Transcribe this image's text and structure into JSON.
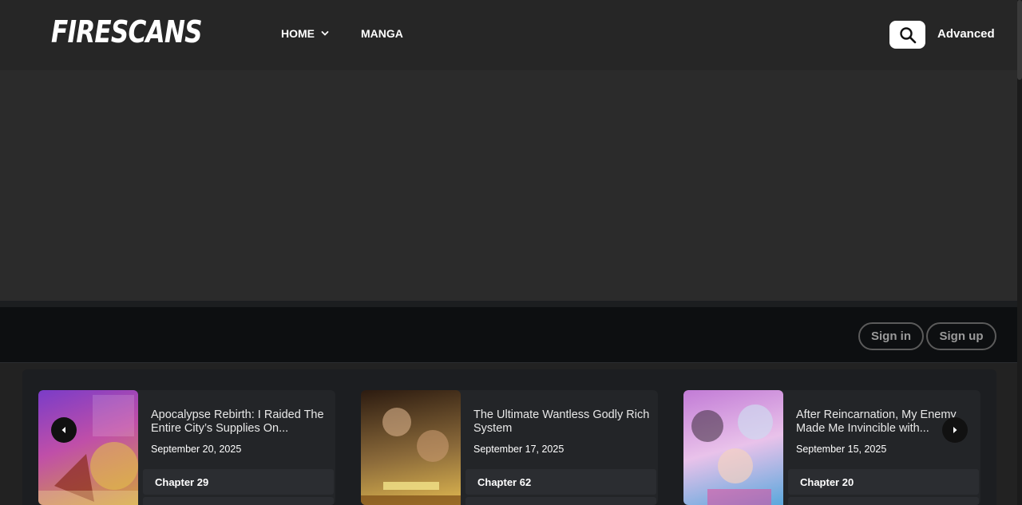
{
  "header": {
    "logo": "FIRESCANS",
    "nav": [
      {
        "label": "HOME",
        "has_dropdown": true
      },
      {
        "label": "MANGA",
        "has_dropdown": false
      }
    ],
    "search_icon": "search-icon",
    "advanced_label": "Advanced"
  },
  "auth": {
    "sign_in": "Sign in",
    "sign_up": "Sign up"
  },
  "slider": {
    "prev_icon": "chevron-left-icon",
    "next_icon": "chevron-right-icon",
    "cards": [
      {
        "title": "Apocalypse Rebirth: I Raided The Entire City’s Supplies On...",
        "date": "September 20, 2025",
        "chapter": "Chapter 29",
        "cover_colors": [
          "#7a3cc8",
          "#c04fa8",
          "#d3a23a"
        ]
      },
      {
        "title": "The Ultimate Wantless Godly Rich System",
        "date": "September 17, 2025",
        "chapter": "Chapter 62",
        "cover_colors": [
          "#2c1b10",
          "#8b6a3a",
          "#e0b850"
        ]
      },
      {
        "title": "After Reincarnation, My Enemy Made Me Invincible with...",
        "date": "September 15, 2025",
        "chapter": "Chapter 20",
        "cover_colors": [
          "#c27bd6",
          "#e9c2ea",
          "#5aa8dd"
        ]
      }
    ]
  },
  "colors": {
    "header_bg": "#262626",
    "hero_bg": "#2b2b2b",
    "authbar_bg": "#0d0f11",
    "card_bg": "#232528"
  }
}
